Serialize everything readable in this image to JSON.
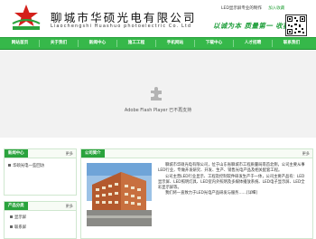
{
  "header": {
    "company_name": "聊城市华硕光电有限公司",
    "company_name_en": "Liaochengshi Huashuo photoelectric Co. Ltd",
    "logo_text": "HSE LED SET",
    "top_links": "LED显示屏专业的制作",
    "favorites": "加入收藏",
    "slogan": "以诚为本  质量第一  收获真情"
  },
  "nav": {
    "items": [
      "网站首页",
      "关于我们",
      "新闻中心",
      "施工工程",
      "手机网站",
      "下载中心",
      "人才招聘",
      "联系我们"
    ]
  },
  "flash": {
    "message": "Adobe Flash Player 已不再支持"
  },
  "news_panel": {
    "title": "新闻中心",
    "more": "更多",
    "items": [
      "华硕光电一些回访"
    ]
  },
  "products_panel": {
    "title": "产品分类",
    "more": "更多",
    "items": [
      "显示屏",
      "联系屏"
    ]
  },
  "about_panel": {
    "title": "公司简介",
    "more": "更多",
    "paragraphs": [
      "聊城市华硕光电有限公司，位于山东省聊城市工程质量局南首北侧，公司主要从事LED行业，专做开发研究、开发、生产、销售光电产品及相关配套工程。",
      "公司主营LED行业显示、工程及控制软件研发生产于一体，公司主要产品有：LED显示屏、LED照明灯具、LED室内外照明及多媒体播放系统、LED电子显示屏、LED全彩显示屏等。",
      "我们将一直致力于LED光电产品研发与服务……[详细]"
    ]
  },
  "colors": {
    "brand_green": "#2aa33d",
    "nav_green": "#36b84a",
    "logo_red": "#d4201b"
  }
}
